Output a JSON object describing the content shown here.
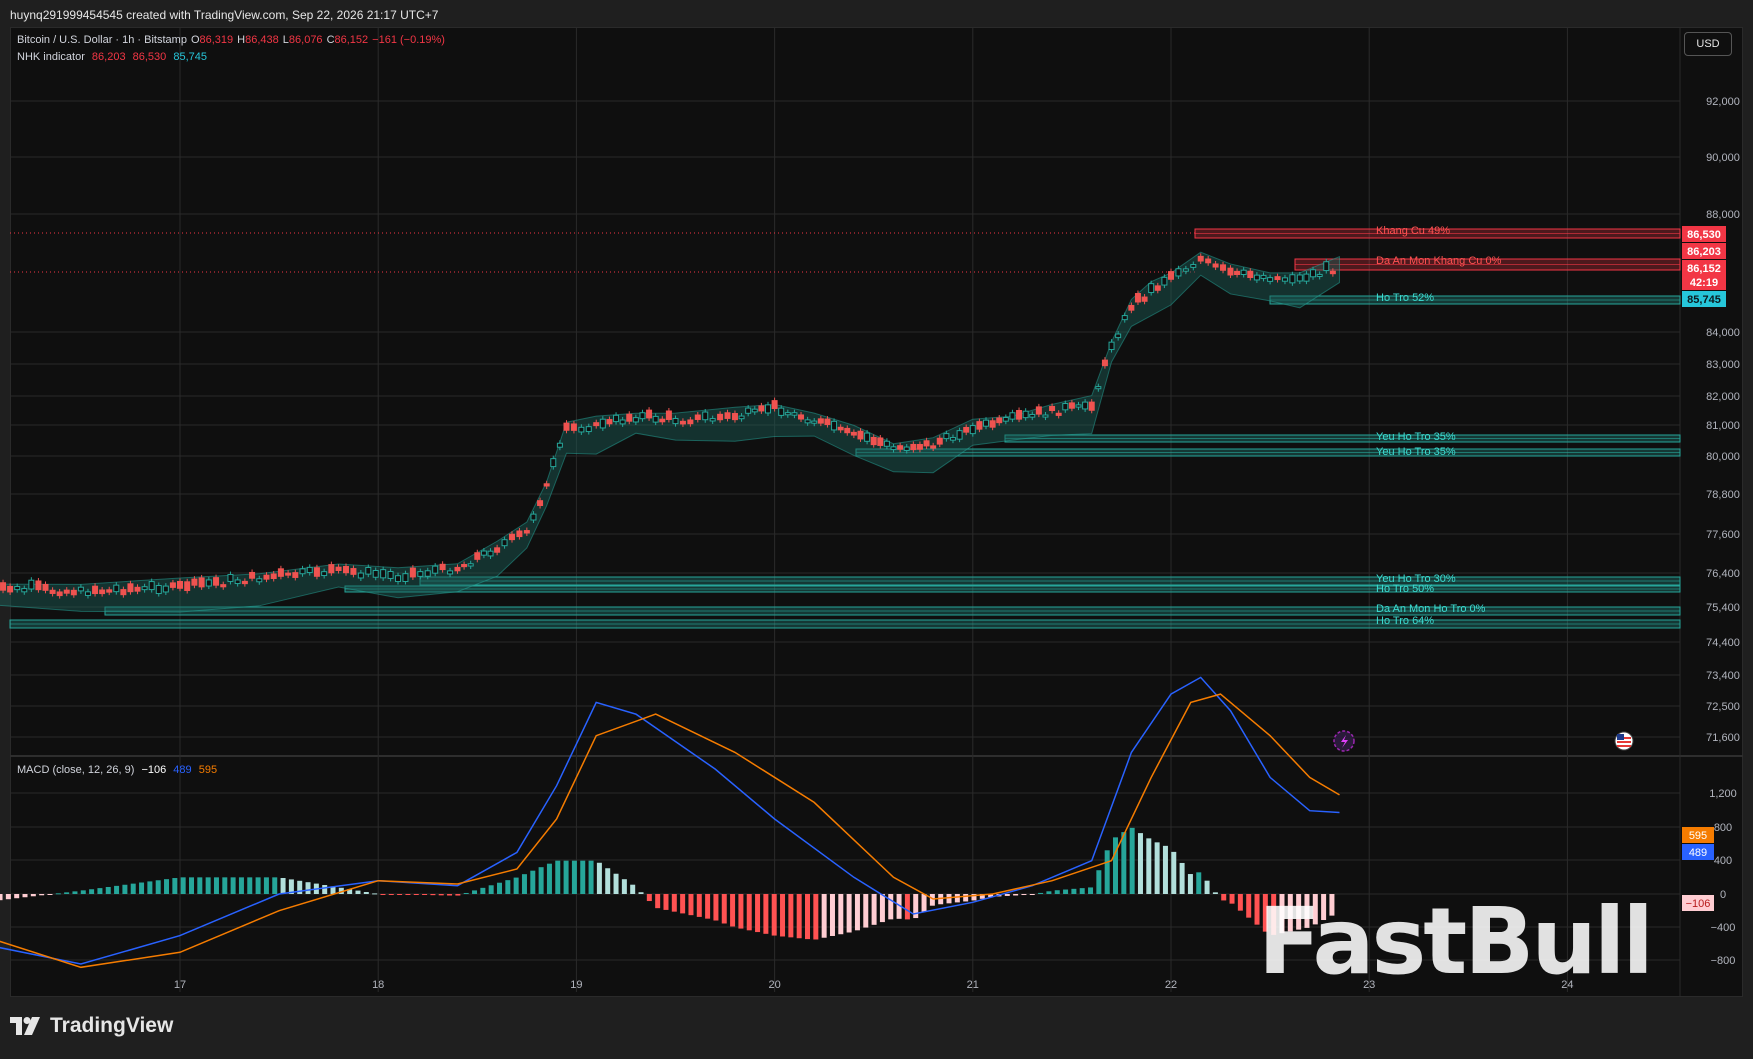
{
  "header": {
    "credit": "huynq291999454545 created with TradingView.com, Sep 22, 2026 21:17 UTC+7"
  },
  "legend": {
    "symbol": "Bitcoin / U.S. Dollar · 1h · Bitstamp",
    "o_label": "O",
    "o": "86,319",
    "h_label": "H",
    "h": "86,438",
    "l_label": "L",
    "l": "86,076",
    "c_label": "C",
    "c": "86,152",
    "change": "−161 (−0.19%)",
    "indicator_name": "NHK indicator",
    "ind_v1": "86,203",
    "ind_v2": "86,530",
    "ind_v3": "85,745",
    "macd_name": "MACD (close, 12, 26, 9)",
    "macd_hist": "−106",
    "macd_line": "489",
    "macd_signal": "595"
  },
  "currency_button": "USD",
  "colors": {
    "bg": "#0f0f0f",
    "grid": "#2a2a2a",
    "up": "#26a69a",
    "down": "#ef5350",
    "red_label": "#f23645",
    "blue": "#2962ff",
    "orange": "#f57c00",
    "teal_label": "#26c6da"
  },
  "price_axis": [
    "92,000",
    "90,000",
    "88,000",
    "84,000",
    "83,000",
    "82,000",
    "81,000",
    "80,000",
    "78,800",
    "77,600",
    "76,400",
    "75,400",
    "74,400",
    "73,400",
    "72,500",
    "71,600"
  ],
  "price_badges": [
    {
      "text": "86,530",
      "color": "#f23645"
    },
    {
      "text": "86,203",
      "color": "#f23645"
    },
    {
      "text": "86,152",
      "color": "#f23645"
    },
    {
      "text": "42:19",
      "color": "#f23645"
    },
    {
      "text": "85,745",
      "color": "#26c6da"
    }
  ],
  "macd_axis": [
    "1,200",
    "800",
    "400",
    "0",
    "−400",
    "−800"
  ],
  "macd_badges": [
    {
      "text": "595",
      "color": "#f57c00"
    },
    {
      "text": "489",
      "color": "#2962ff"
    },
    {
      "text": "−106",
      "color": "#ffcdd2"
    }
  ],
  "time_axis": [
    "17",
    "18",
    "19",
    "20",
    "21",
    "22",
    "23",
    "24"
  ],
  "zones": [
    {
      "label": "Khang Cu 49%",
      "color": "#f23645"
    },
    {
      "label": "Da An Mon Khang Cu 0%",
      "color": "#f23645"
    },
    {
      "label": "Ho Tro 52%",
      "color": "#26a69a"
    },
    {
      "label": "Yeu Ho Tro 35%",
      "color": "#26a69a"
    },
    {
      "label": "Yeu Ho Tro 35%",
      "color": "#26a69a"
    },
    {
      "label": "Yeu Ho Tro 30%",
      "color": "#26a69a"
    },
    {
      "label": "Ho Tro 50%",
      "color": "#26a69a"
    },
    {
      "label": "Da An Mon Ho Tro 0%",
      "color": "#26a69a"
    },
    {
      "label": "Ho Tro 64%",
      "color": "#26a69a"
    }
  ],
  "footer": {
    "brand": "TradingView"
  },
  "watermark": "FastBull",
  "chart_data": {
    "type": "candlestick",
    "x_ticks": [
      "17",
      "18",
      "19",
      "20",
      "21",
      "22",
      "23",
      "24"
    ],
    "price_ticks": [
      92000,
      90000,
      88000,
      84000,
      83000,
      82000,
      81000,
      80000,
      78800,
      77600,
      76400,
      75400,
      74400,
      73400,
      72500,
      71600
    ],
    "close_path": [
      [
        16.0,
        75.9
      ],
      [
        16.5,
        75.8
      ],
      [
        17.0,
        75.9
      ],
      [
        17.4,
        76.2
      ],
      [
        17.8,
        76.4
      ],
      [
        18.1,
        76.2
      ],
      [
        18.4,
        76.5
      ],
      [
        18.6,
        77.1
      ],
      [
        18.75,
        77.6
      ],
      [
        18.85,
        79.0
      ],
      [
        18.95,
        80.8
      ],
      [
        19.1,
        80.9
      ],
      [
        19.3,
        81.2
      ],
      [
        19.5,
        81.1
      ],
      [
        19.8,
        81.2
      ],
      [
        20.0,
        81.5
      ],
      [
        20.2,
        81.1
      ],
      [
        20.4,
        80.6
      ],
      [
        20.6,
        80.2
      ],
      [
        20.8,
        80.3
      ],
      [
        21.0,
        80.8
      ],
      [
        21.2,
        81.1
      ],
      [
        21.4,
        81.4
      ],
      [
        21.6,
        81.6
      ],
      [
        21.7,
        83.5
      ],
      [
        21.8,
        84.8
      ],
      [
        21.9,
        85.3
      ],
      [
        22.0,
        85.8
      ],
      [
        22.15,
        86.4
      ],
      [
        22.3,
        85.9
      ],
      [
        22.5,
        85.8
      ],
      [
        22.65,
        85.7
      ],
      [
        22.85,
        86.15
      ]
    ],
    "macd_line": [
      [
        16.0,
        -300
      ],
      [
        16.5,
        -420
      ],
      [
        17.0,
        -250
      ],
      [
        17.5,
        0
      ],
      [
        18.0,
        80
      ],
      [
        18.4,
        50
      ],
      [
        18.7,
        250
      ],
      [
        18.9,
        650
      ],
      [
        19.1,
        1150
      ],
      [
        19.3,
        1080
      ],
      [
        19.7,
        750
      ],
      [
        20.0,
        450
      ],
      [
        20.4,
        100
      ],
      [
        20.7,
        -120
      ],
      [
        21.0,
        -50
      ],
      [
        21.3,
        50
      ],
      [
        21.6,
        200
      ],
      [
        21.8,
        850
      ],
      [
        22.0,
        1200
      ],
      [
        22.15,
        1300
      ],
      [
        22.3,
        1100
      ],
      [
        22.5,
        700
      ],
      [
        22.7,
        500
      ],
      [
        22.85,
        489
      ]
    ],
    "signal_line": [
      [
        16.0,
        -250
      ],
      [
        16.5,
        -440
      ],
      [
        17.0,
        -350
      ],
      [
        17.5,
        -100
      ],
      [
        18.0,
        80
      ],
      [
        18.4,
        60
      ],
      [
        18.7,
        150
      ],
      [
        18.9,
        450
      ],
      [
        19.1,
        950
      ],
      [
        19.4,
        1080
      ],
      [
        19.8,
        850
      ],
      [
        20.2,
        550
      ],
      [
        20.6,
        100
      ],
      [
        20.8,
        -30
      ],
      [
        21.1,
        0
      ],
      [
        21.4,
        80
      ],
      [
        21.7,
        200
      ],
      [
        21.9,
        700
      ],
      [
        22.1,
        1150
      ],
      [
        22.25,
        1200
      ],
      [
        22.5,
        950
      ],
      [
        22.7,
        700
      ],
      [
        22.85,
        595
      ]
    ],
    "macd_last": {
      "histogram": -106,
      "macd": 489,
      "signal": 595
    }
  }
}
